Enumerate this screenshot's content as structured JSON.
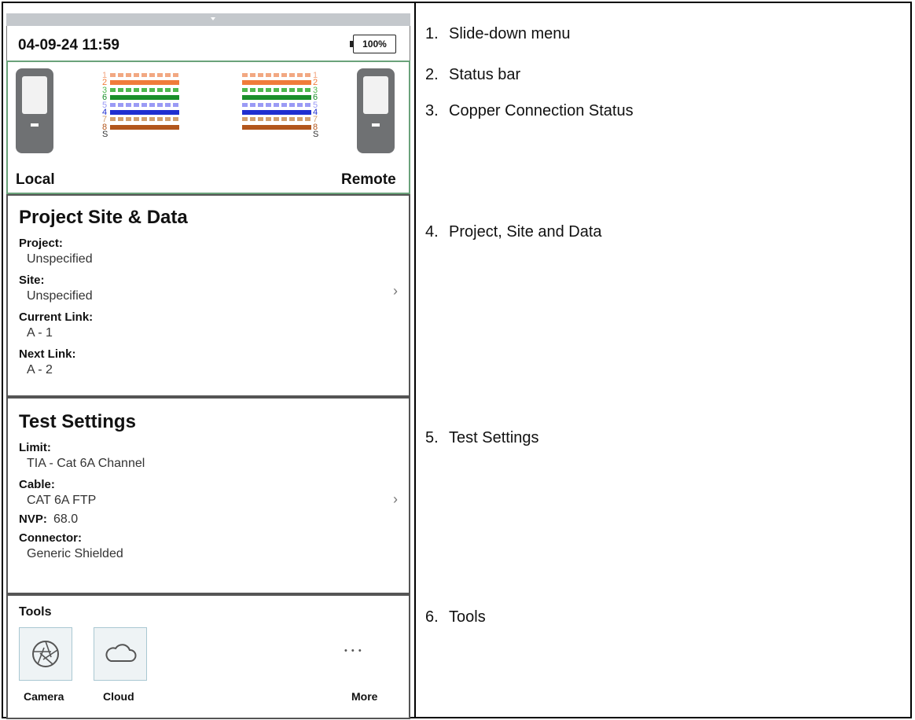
{
  "status_bar": {
    "datetime": "04-09-24 11:59",
    "battery": "100%"
  },
  "copper": {
    "local_label": "Local",
    "remote_label": "Remote",
    "pin_numbers": [
      "1",
      "2",
      "3",
      "6",
      "5",
      "4",
      "7",
      "8",
      "S"
    ],
    "wire_colors": [
      "#f2a882",
      "#f07c3a",
      "#4fb84f",
      "#1a8f2a",
      "#9a9af5",
      "#1f2fd0",
      "#d2a070",
      "#b2561c"
    ]
  },
  "project": {
    "title": "Project Site & Data",
    "project_label": "Project:",
    "project_value": "Unspecified",
    "site_label": "Site:",
    "site_value": "Unspecified",
    "current_link_label": "Current Link:",
    "current_link_value": "A - 1",
    "next_link_label": "Next Link:",
    "next_link_value": "A - 2"
  },
  "test_settings": {
    "title": "Test Settings",
    "limit_label": "Limit:",
    "limit_value": "TIA - Cat 6A Channel",
    "cable_label": "Cable:",
    "cable_value": "CAT 6A FTP",
    "nvp_label": "NVP:",
    "nvp_value": "68.0",
    "connector_label": "Connector:",
    "connector_value": "Generic Shielded"
  },
  "tools": {
    "title": "Tools",
    "camera_label": "Camera",
    "cloud_label": "Cloud",
    "more_label": "More",
    "more_glyph": "• • •"
  },
  "chevron": "›",
  "legend": [
    {
      "num": "1.",
      "text": "Slide-down menu"
    },
    {
      "num": "2.",
      "text": "Status bar"
    },
    {
      "num": "3.",
      "text": "Copper Connection Status"
    },
    {
      "num": "4.",
      "text": "Project, Site and Data"
    },
    {
      "num": "5.",
      "text": "Test Settings"
    },
    {
      "num": "6.",
      "text": "Tools"
    }
  ]
}
